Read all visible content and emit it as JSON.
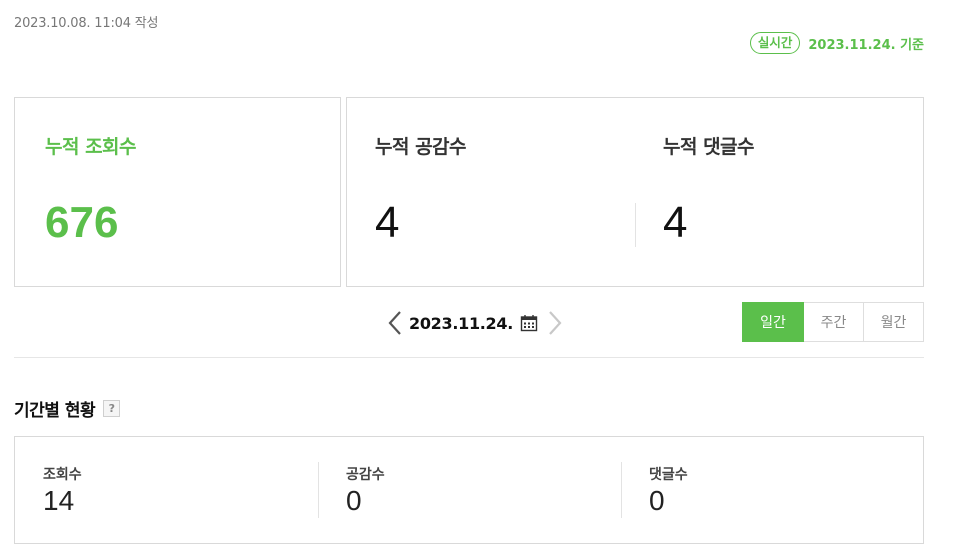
{
  "written_at": "2023.10.08. 11:04 작성",
  "basis": {
    "realtime_label": "실시간",
    "date_label": "2023.11.24. 기준"
  },
  "cumulative": {
    "views_label": "누적 조회수",
    "views_value": "676",
    "likes_label": "누적 공감수",
    "likes_value": "4",
    "comments_label": "누적 댓글수",
    "comments_value": "4"
  },
  "date_nav": {
    "date": "2023.11.24.",
    "prev_icon": "chevron-left-icon",
    "next_icon": "chevron-right-icon",
    "calendar_icon": "calendar-icon",
    "next_disabled": true
  },
  "period_tabs": [
    {
      "label": "일간",
      "active": true
    },
    {
      "label": "주간",
      "active": false
    },
    {
      "label": "월간",
      "active": false
    }
  ],
  "period_section": {
    "title": "기간별 현황",
    "help_label": "?",
    "items": [
      {
        "label": "조회수",
        "value": "14"
      },
      {
        "label": "공감수",
        "value": "0"
      },
      {
        "label": "댓글수",
        "value": "0"
      }
    ]
  },
  "colors": {
    "accent": "#5bbf4b",
    "border": "#d9d9d9"
  }
}
